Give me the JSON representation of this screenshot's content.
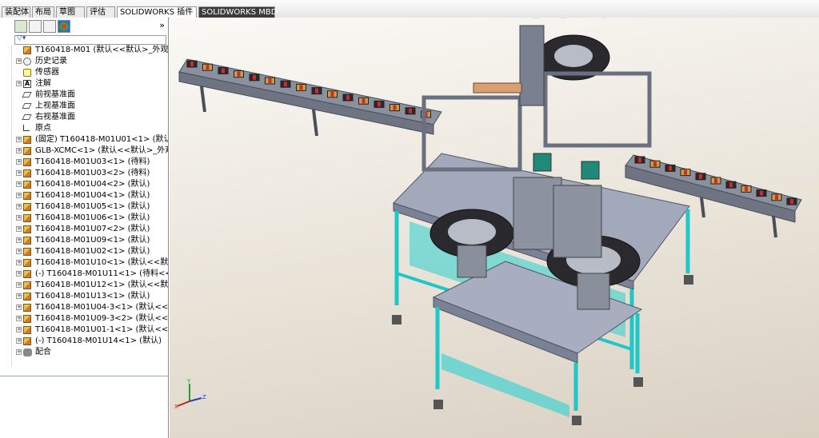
{
  "command_tabs": [
    {
      "label": "装配体",
      "active": false,
      "dark": false
    },
    {
      "label": "布局",
      "active": false,
      "dark": false
    },
    {
      "label": "草图",
      "active": false,
      "dark": false
    },
    {
      "label": "评估",
      "active": false,
      "dark": false
    },
    {
      "label": "SOLIDWORKS 插件",
      "active": true,
      "dark": false
    },
    {
      "label": "SOLIDWORKS MBD",
      "active": false,
      "dark": true
    }
  ],
  "panel": {
    "collapse_label": "»"
  },
  "tree": {
    "items": [
      {
        "label": "T160418-M01  (默认<<默认>_外观 显示",
        "icon": "asm",
        "expand": ""
      },
      {
        "label": "历史记录",
        "icon": "hist",
        "expand": "+"
      },
      {
        "label": "传感器",
        "icon": "sens",
        "expand": ""
      },
      {
        "label": "注解",
        "icon": "note",
        "expand": "+"
      },
      {
        "label": "前视基准面",
        "icon": "plane",
        "expand": ""
      },
      {
        "label": "上视基准面",
        "icon": "plane",
        "expand": ""
      },
      {
        "label": "右视基准面",
        "icon": "plane",
        "expand": ""
      },
      {
        "label": "原点",
        "icon": "origin",
        "expand": ""
      },
      {
        "label": "(固定) T160418-M01U01<1> (默认)",
        "icon": "asm",
        "expand": "+"
      },
      {
        "label": "GLB-XCMC<1> (默认<<默认>_外观 显",
        "icon": "asm",
        "expand": "+"
      },
      {
        "label": "T160418-M01U03<1> (待料)",
        "icon": "asm",
        "expand": "+"
      },
      {
        "label": "T160418-M01U03<2> (待料)",
        "icon": "asm",
        "expand": "+"
      },
      {
        "label": "T160418-M01U04<2> (默认)",
        "icon": "asm",
        "expand": "+"
      },
      {
        "label": "T160418-M01U04<1> (默认)",
        "icon": "asm",
        "expand": "+"
      },
      {
        "label": "T160418-M01U05<1> (默认)",
        "icon": "asm",
        "expand": "+"
      },
      {
        "label": "T160418-M01U06<1> (默认)",
        "icon": "asm",
        "expand": "+"
      },
      {
        "label": "T160418-M01U07<2> (默认)",
        "icon": "asm",
        "expand": "+"
      },
      {
        "label": "T160418-M01U09<1> (默认)",
        "icon": "asm",
        "expand": "+"
      },
      {
        "label": "T160418-M01U02<1> (默认)",
        "icon": "asm",
        "expand": "+"
      },
      {
        "label": "T160418-M01U10<1> (默认<<默认>",
        "icon": "asm",
        "expand": "+"
      },
      {
        "label": "(-) T160418-M01U11<1> (待料<<待",
        "icon": "asm",
        "expand": "+"
      },
      {
        "label": "T160418-M01U12<1> (默认<<默认>",
        "icon": "asm",
        "expand": "+"
      },
      {
        "label": "T160418-M01U13<1> (默认)",
        "icon": "asm",
        "expand": "+"
      },
      {
        "label": "T160418-M01U04-3<1> (默认<<默认",
        "icon": "asm",
        "expand": "+"
      },
      {
        "label": "T160418-M01U09-3<2> (默认<<默认",
        "icon": "asm",
        "expand": "+"
      },
      {
        "label": "T160418-M01U01-1<1> (默认<<默认",
        "icon": "asm",
        "expand": "+"
      },
      {
        "label": "(-) T160418-M01U14<1> (默认)",
        "icon": "asm",
        "expand": "+"
      },
      {
        "label": "配合",
        "icon": "mate",
        "expand": "+"
      }
    ]
  },
  "icons": {
    "hud": [
      "zoom-to-fit-icon",
      "zoom-area-icon",
      "previous-view-icon",
      "section-view-icon",
      "dynamic-annotation-icon",
      "view-orientation-icon",
      "display-style-icon",
      "hide-show-icon",
      "edit-appearance-icon",
      "apply-scene-icon",
      "view-settings-icon"
    ]
  },
  "colors": {
    "frame_teal": "#1ec8c8",
    "table_top": "#9aa3b5",
    "conveyor": "#7c8292",
    "background_light": "#faf9f5",
    "background_dark": "#d9d0c2"
  }
}
